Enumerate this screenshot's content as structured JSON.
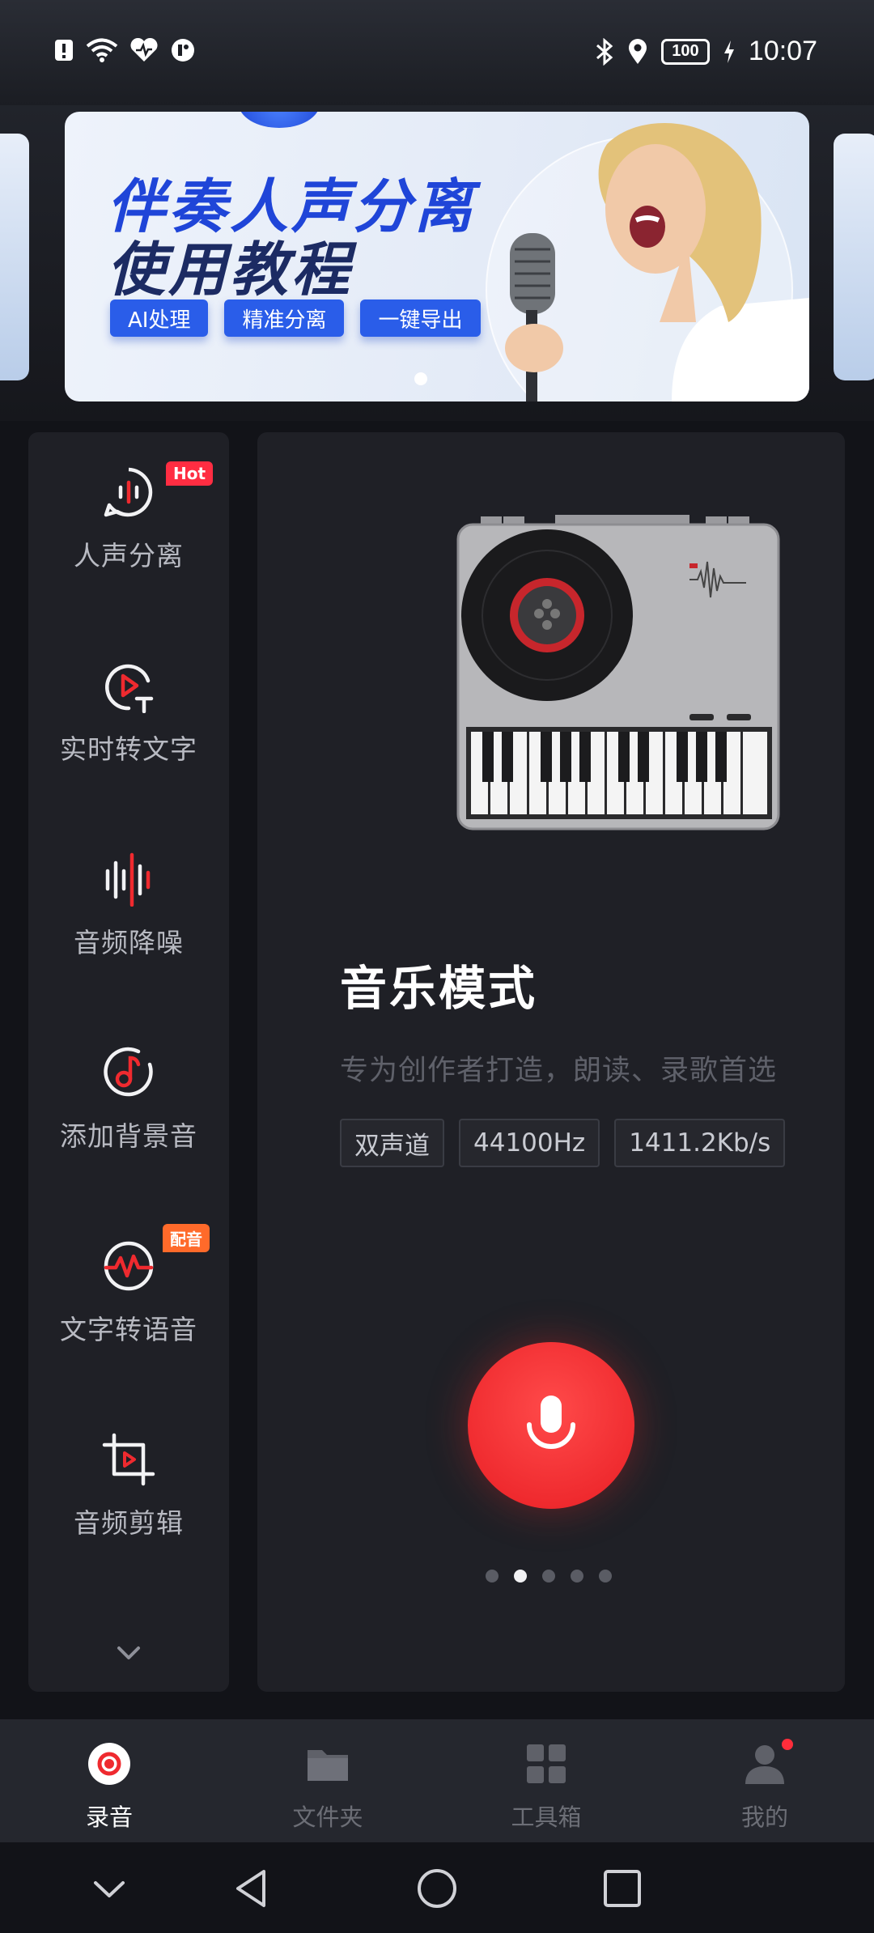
{
  "status_bar": {
    "time": "10:07",
    "battery": "100",
    "left_icons": [
      "alert-icon",
      "wifi-icon",
      "health-icon",
      "app-icon"
    ],
    "right_icons": [
      "bluetooth-icon",
      "location-icon",
      "battery-icon",
      "charging-icon"
    ]
  },
  "banner": {
    "title_line1": "伴奏人声分离",
    "title_line2": "使用教程",
    "tags": [
      "AI处理",
      "精准分离",
      "一键导出"
    ]
  },
  "tools": [
    {
      "label": "人声分离",
      "icon": "voice-separation-icon",
      "badge": "Hot"
    },
    {
      "label": "实时转文字",
      "icon": "realtime-transcribe-icon",
      "badge": ""
    },
    {
      "label": "音频降噪",
      "icon": "noise-reduction-icon",
      "badge": ""
    },
    {
      "label": "添加背景音",
      "icon": "background-music-icon",
      "badge": ""
    },
    {
      "label": "文字转语音",
      "icon": "text-to-speech-icon",
      "badge": "配音"
    },
    {
      "label": "音频剪辑",
      "icon": "audio-crop-icon",
      "badge": ""
    }
  ],
  "mode": {
    "title": "音乐模式",
    "description": "专为创作者打造，朗读、录歌首选",
    "specs": [
      "双声道",
      "44100Hz",
      "1411.2Kb/s"
    ],
    "page_count": 5,
    "active_page": 2
  },
  "bottom_nav": [
    {
      "label": "录音",
      "icon": "record-icon",
      "active": true
    },
    {
      "label": "文件夹",
      "icon": "folder-icon",
      "active": false
    },
    {
      "label": "工具箱",
      "icon": "toolbox-icon",
      "active": false
    },
    {
      "label": "我的",
      "icon": "profile-icon",
      "active": false
    }
  ],
  "colors": {
    "accent": "#ef2a2f",
    "hot_badge": "#ff2d42",
    "dub_badge": "#ff6a2a",
    "banner_tag": "#2a5de9",
    "panel_bg": "#1f2026"
  }
}
